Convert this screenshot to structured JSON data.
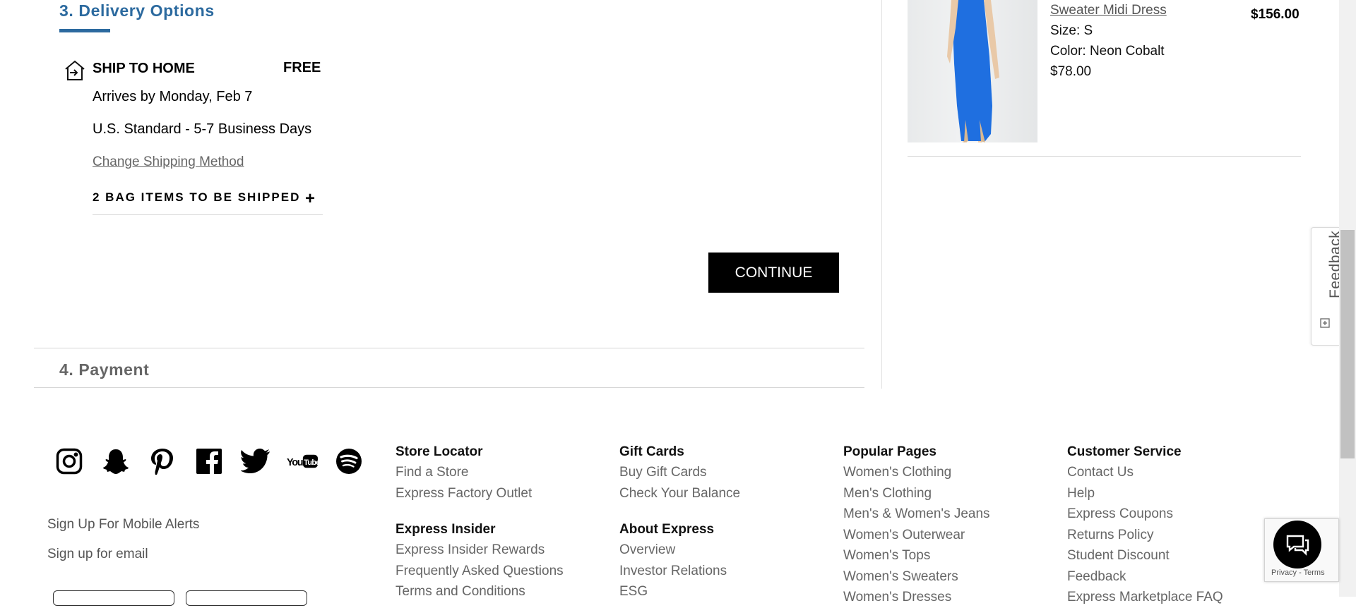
{
  "delivery": {
    "step_title": "3. Delivery Options",
    "ship_label": "SHIP TO HOME",
    "price_label": "FREE",
    "arrives": "Arrives by Monday, Feb 7",
    "method": "U.S. Standard - 5-7 Business Days",
    "change_link": "Change Shipping Method",
    "bag_items": "2 BAG ITEMS TO BE SHIPPED",
    "bag_toggle": "+",
    "continue_label": "CONTINUE"
  },
  "payment": {
    "step_title": "4. Payment"
  },
  "order_item": {
    "name": "Sweater Midi Dress",
    "size": "Size: S",
    "color": "Color: Neon Cobalt",
    "price": "$78.00",
    "total": "$156.00",
    "image_color": "#1f6fe0"
  },
  "feedback_tab": {
    "label": "Feedback"
  },
  "footer": {
    "social": [
      "instagram-icon",
      "snapchat-icon",
      "pinterest-icon",
      "facebook-icon",
      "twitter-icon",
      "youtube-icon",
      "spotify-icon"
    ],
    "youtube_text": "You Tube",
    "mobile_alerts": "Sign Up For Mobile Alerts",
    "email_signup": "Sign up for email",
    "columns": [
      {
        "groups": [
          {
            "heading": "Store Locator",
            "links": [
              "Find a Store",
              "Express Factory Outlet"
            ]
          },
          {
            "heading": "Express Insider",
            "links": [
              "Express Insider Rewards",
              "Frequently Asked Questions",
              "Terms and Conditions"
            ]
          }
        ]
      },
      {
        "groups": [
          {
            "heading": "Gift Cards",
            "links": [
              "Buy Gift Cards",
              "Check Your Balance"
            ]
          },
          {
            "heading": "About Express",
            "links": [
              "Overview",
              "Investor Relations",
              "ESG"
            ]
          }
        ]
      },
      {
        "groups": [
          {
            "heading": "Popular Pages",
            "links": [
              "Women's Clothing",
              "Men's Clothing",
              "Men's & Women's Jeans",
              "Women's Outerwear",
              "Women's Tops",
              "Women's Sweaters",
              "Women's Dresses"
            ]
          }
        ]
      },
      {
        "groups": [
          {
            "heading": "Customer Service",
            "links": [
              "Contact Us",
              "Help",
              "Express Coupons",
              "Returns Policy",
              "Student Discount",
              "Feedback",
              "Express Marketplace FAQ"
            ]
          }
        ]
      }
    ]
  },
  "recaptcha": {
    "text": "Privacy - Terms"
  },
  "colors": {
    "accent": "#2c6a9f",
    "button": "#000000",
    "link_gray": "#666666"
  }
}
